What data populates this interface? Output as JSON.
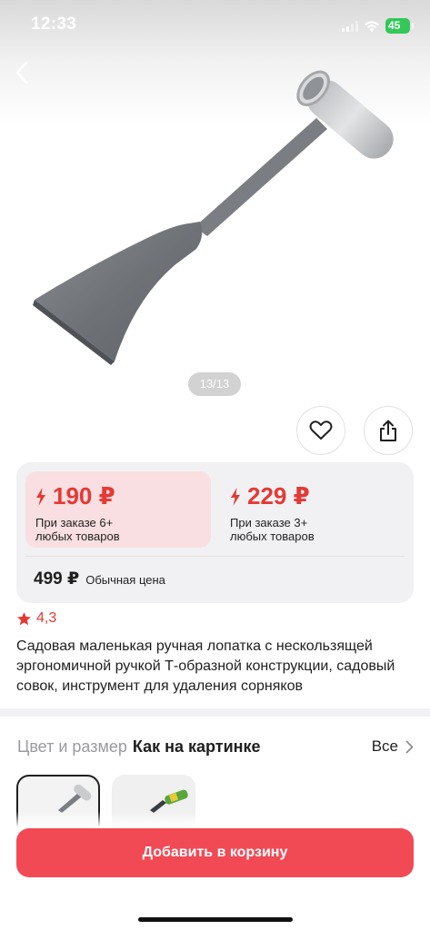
{
  "status_bar": {
    "time": "12:33",
    "battery": "45"
  },
  "gallery": {
    "counter": "13/13"
  },
  "prices": {
    "tiers": [
      {
        "price": "190 ₽",
        "condition": "При заказе 6+ любых товаров"
      },
      {
        "price": "229 ₽",
        "condition": "При заказе 3+ любых товаров"
      }
    ],
    "regular_price": "499 ₽",
    "regular_label": "Обычная цена"
  },
  "rating": {
    "value": "4,3"
  },
  "product": {
    "title": "Садовая маленькая ручная лопатка с нескользящей эргономичной ручкой Т-образной конструкции, садовый совок, инструмент для удаления сорняков"
  },
  "variant": {
    "label": "Цвет и размер",
    "value": "Как на картинке",
    "all_label": "Все"
  },
  "actions": {
    "add_to_cart": "Добавить в корзину"
  },
  "colors": {
    "accent_red": "#e53935",
    "cart_button": "#f24a55",
    "tier_highlight": "#f9dfe1",
    "card_bg": "#f1f1f4"
  },
  "icons": [
    "back-arrow-icon",
    "heart-icon",
    "share-icon",
    "lightning-icon",
    "star-icon",
    "chevron-right-icon",
    "wifi-icon",
    "signal-icon",
    "battery-icon"
  ]
}
